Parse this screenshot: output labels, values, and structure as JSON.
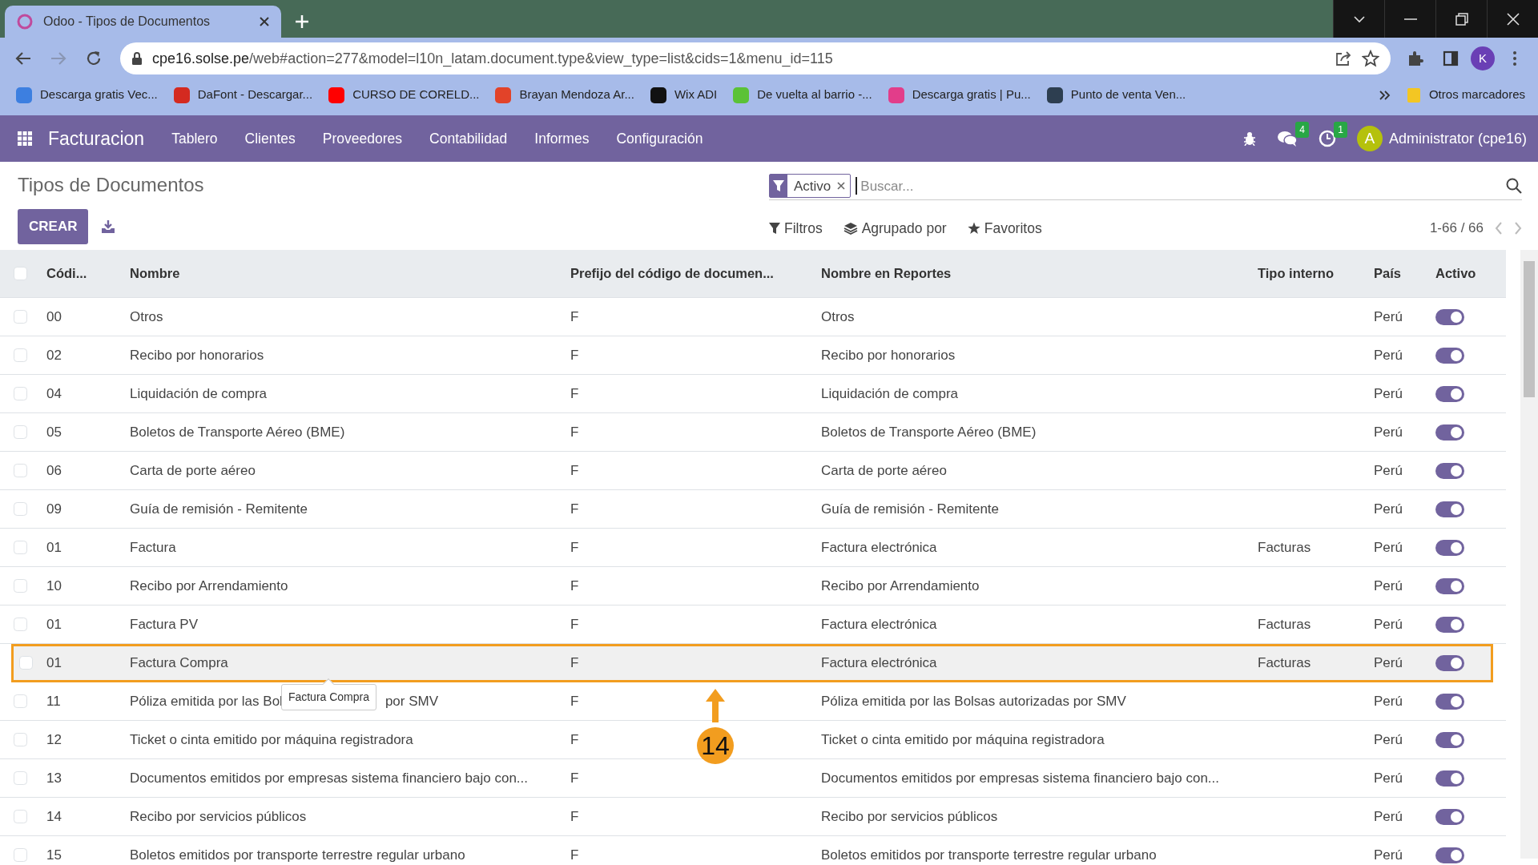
{
  "browser": {
    "tab_title": "Odoo - Tipos de Documentos",
    "url_host": "cpe16.solse.pe",
    "url_path": "/web#action=277&model=l10n_latam.document.type&view_type=list&cids=1&menu_id=115",
    "profile_initial": "K",
    "bookmarks": [
      {
        "label": "Descarga gratis Vec...",
        "color": "#3d7fe0"
      },
      {
        "label": "DaFont - Descargar...",
        "color": "#d42a20"
      },
      {
        "label": "CURSO DE CORELD...",
        "color": "#ff0000"
      },
      {
        "label": "Brayan Mendoza Ar...",
        "color": "#e24329"
      },
      {
        "label": "Wix ADI",
        "color": "#111111"
      },
      {
        "label": "De vuelta al barrio -...",
        "color": "#5bc236"
      },
      {
        "label": "Descarga gratis | Pu...",
        "color": "#e23d8a"
      },
      {
        "label": "Punto de venta Ven...",
        "color": "#2d3e50"
      }
    ],
    "other_bookmarks": "Otros marcadores"
  },
  "app": {
    "name": "Facturacion",
    "menu": [
      "Tablero",
      "Clientes",
      "Proveedores",
      "Contabilidad",
      "Informes",
      "Configuración"
    ],
    "messages_count": "4",
    "activities_count": "1",
    "user_initial": "A",
    "user": "Administrator (cpe16)"
  },
  "page": {
    "title": "Tipos de Documentos",
    "create_button": "CREAR",
    "search": {
      "facet": "Activo",
      "placeholder": "Buscar..."
    },
    "filters": [
      {
        "kind": "filter",
        "label": "Filtros"
      },
      {
        "kind": "group",
        "label": "Agrupado por"
      },
      {
        "kind": "favorite",
        "label": "Favoritos"
      }
    ],
    "pager": "1-66 / 66"
  },
  "table": {
    "select_all_checked": false,
    "columns": [
      "Códi...",
      "Nombre",
      "Prefijo del código de documen...",
      "Nombre en Reportes",
      "Tipo interno",
      "País",
      "Activo"
    ],
    "rows": [
      {
        "code": "00",
        "name": "Otros",
        "prefix": "F",
        "report_name": "Otros",
        "country": "Perú",
        "active": true,
        "checked": false,
        "highlighted": false
      },
      {
        "code": "02",
        "name": "Recibo por honorarios",
        "prefix": "F",
        "report_name": "Recibo por honorarios",
        "country": "Perú",
        "active": true,
        "checked": false,
        "highlighted": false
      },
      {
        "code": "04",
        "name": "Liquidación de compra",
        "prefix": "F",
        "report_name": "Liquidación de compra",
        "country": "Perú",
        "active": true,
        "checked": false,
        "highlighted": false
      },
      {
        "code": "05",
        "name": "Boletos de Transporte Aéreo (BME)",
        "prefix": "F",
        "report_name": "Boletos de Transporte Aéreo (BME)",
        "country": "Perú",
        "active": true,
        "checked": false,
        "highlighted": false
      },
      {
        "code": "06",
        "name": "Carta de porte aéreo",
        "prefix": "F",
        "report_name": "Carta de porte aéreo",
        "country": "Perú",
        "active": true,
        "checked": false,
        "highlighted": false
      },
      {
        "code": "09",
        "name": "Guía de remisión - Remitente",
        "prefix": "F",
        "report_name": "Guía de remisión - Remitente",
        "country": "Perú",
        "active": true,
        "checked": false,
        "highlighted": false
      },
      {
        "code": "01",
        "name": "Factura",
        "prefix": "F",
        "report_name": "Factura electrónica",
        "internal_type": "Facturas",
        "country": "Perú",
        "active": true,
        "checked": false,
        "highlighted": false
      },
      {
        "code": "10",
        "name": "Recibo por Arrendamiento",
        "prefix": "F",
        "report_name": "Recibo por Arrendamiento",
        "country": "Perú",
        "active": true,
        "checked": false,
        "highlighted": false
      },
      {
        "code": "01",
        "name": "Factura PV",
        "prefix": "F",
        "report_name": "Factura electrónica",
        "internal_type": "Facturas",
        "country": "Perú",
        "active": true,
        "checked": false,
        "highlighted": false
      },
      {
        "code": "01",
        "name": "Factura Compra",
        "prefix": "F",
        "report_name": "Factura electrónica",
        "internal_type": "Facturas",
        "country": "Perú",
        "active": true,
        "checked": false,
        "highlighted": true
      },
      {
        "code": "11",
        "name": "Póliza emitida por las Bol",
        "name_tail": "por SMV",
        "prefix": "F",
        "report_name": "Póliza emitida por las Bolsas autorizadas por SMV",
        "country": "Perú",
        "active": true,
        "checked": false,
        "highlighted": false
      },
      {
        "code": "12",
        "name": "Ticket o cinta emitido por máquina registradora",
        "prefix": "F",
        "report_name": "Ticket o cinta emitido por máquina registradora",
        "country": "Perú",
        "active": true,
        "checked": false,
        "highlighted": false
      },
      {
        "code": "13",
        "name": "Documentos emitidos por empresas sistema financiero bajo con...",
        "prefix": "F",
        "report_name": "Documentos emitidos por empresas sistema financiero bajo con...",
        "country": "Perú",
        "active": true,
        "checked": false,
        "highlighted": false
      },
      {
        "code": "14",
        "name": "Recibo por servicios públicos",
        "prefix": "F",
        "report_name": "Recibo por servicios públicos",
        "country": "Perú",
        "active": true,
        "checked": false,
        "highlighted": false
      },
      {
        "code": "15",
        "name": "Boletos emitidos por transporte terrestre regular urbano",
        "prefix": "F",
        "report_name": "Boletos emitidos por transporte terrestre regular urbano",
        "country": "Perú",
        "active": true,
        "checked": false,
        "highlighted": false
      }
    ]
  },
  "tooltip": "Factura Compra",
  "annotation": {
    "label": "14"
  }
}
